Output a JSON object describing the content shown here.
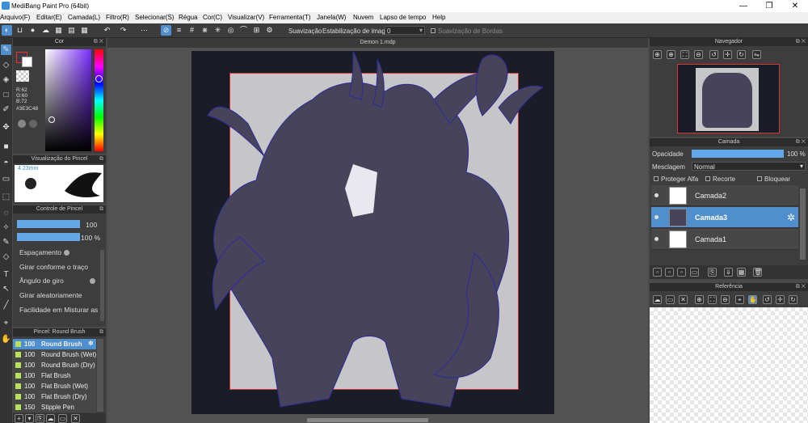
{
  "window": {
    "title": "MediBang Paint Pro (64bit)",
    "min": "—",
    "max": "❐",
    "close": "✕"
  },
  "menu": [
    "Arquivo(F)",
    "Editar(E)",
    "Camada(L)",
    "Filtro(R)",
    "Selecionar(S)",
    "Régua",
    "Cor(C)",
    "Visualizar(V)",
    "Ferramenta(T)",
    "Janela(W)",
    "Nuvem",
    "Lapso de tempo",
    "Help"
  ],
  "toolbar": {
    "smoothing_label": "Suavização",
    "stabilization_label": "Estabilização de imagens",
    "stabilization_value": "0",
    "edge_smoothing_label": "Suavização de Bordas"
  },
  "color_panel": {
    "title": "Cor",
    "r": "R:62",
    "g": "G:60",
    "b": "B:72",
    "hex": "#3E3C48",
    "current_color": "#3E3C48"
  },
  "brush_preview": {
    "title": "Visualização do Pincel",
    "size": "4.23mm"
  },
  "brush_control": {
    "title": "Controle de Pincel",
    "size_value": "100",
    "size_fraction": 1.0,
    "opacity_value": "100 %",
    "opacity_fraction": 1.0,
    "items": [
      "Espaçamento",
      "Girar conforme o traço",
      "Ângulo de giro",
      "Girar aleatoriamente",
      "Facilidade em Misturar as"
    ]
  },
  "brush_list": {
    "title": "Pincel: Round Brush",
    "items": [
      {
        "size": "100",
        "name": "Round Brush"
      },
      {
        "size": "100",
        "name": "Round Brush (Wet)"
      },
      {
        "size": "100",
        "name": "Round Brush (Dry)"
      },
      {
        "size": "100",
        "name": "Flat Brush"
      },
      {
        "size": "100",
        "name": "Flat Brush (Wet)"
      },
      {
        "size": "100",
        "name": "Flat Brush (Dry)"
      },
      {
        "size": "150",
        "name": "Stipple Pen"
      }
    ]
  },
  "document": {
    "tab": "Demon 1.mdp"
  },
  "navigator": {
    "title": "Navegador"
  },
  "layer_panel": {
    "title": "Camada",
    "opacity_label": "Opacidade",
    "opacity_value": "100 %",
    "opacity_fraction": 1.0,
    "blend_label": "Mesclagem",
    "blend_value": "Normal",
    "protect_alpha": "Proteger Alfa",
    "clip": "Recorte",
    "lock": "Bloquear",
    "layers": [
      "Camada2",
      "Camada3",
      "Camada1"
    ]
  },
  "reference": {
    "title": "Referência"
  }
}
